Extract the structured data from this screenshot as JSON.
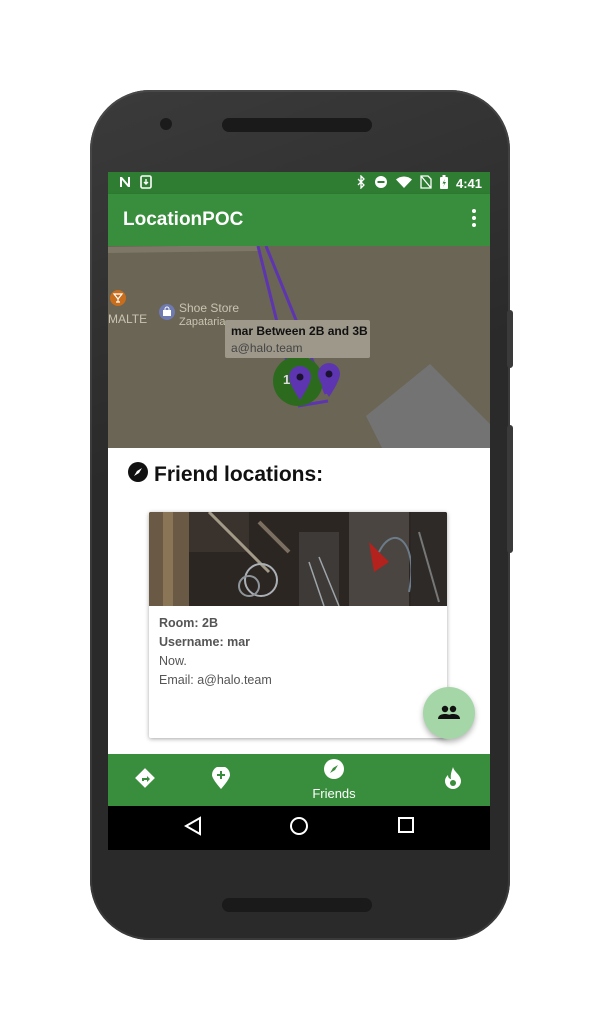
{
  "status_bar": {
    "time": "4:41",
    "left_icons": [
      "notification-n-icon",
      "download-icon"
    ],
    "right_icons": [
      "bluetooth-icon",
      "do-not-disturb-icon",
      "wifi-icon",
      "no-sim-icon",
      "battery-charging-icon"
    ]
  },
  "app_bar": {
    "title": "LocationPOC",
    "menu_icon": "overflow-menu-icon"
  },
  "map": {
    "poi_1_label": "MALTE",
    "poi_2_label": "Shoe Store",
    "poi_2_sublabel": "Zapataria",
    "cluster_label": "1+",
    "info_window": {
      "title": "mar Between 2B and 3B",
      "subtitle": "a@halo.team"
    }
  },
  "friends": {
    "heading": "Friend locations:",
    "heading_icon": "compass-icon",
    "card": {
      "room": "Room: 2B",
      "username": "Username: mar",
      "time": "Now.",
      "email": "Email: a@halo.team"
    }
  },
  "fab": {
    "icon": "people-icon"
  },
  "bottom_nav": {
    "items": [
      {
        "icon": "directions-icon",
        "label": ""
      },
      {
        "icon": "add-location-icon",
        "label": ""
      },
      {
        "icon": "compass-icon",
        "label": "Friends"
      },
      {
        "icon": "flame-icon",
        "label": ""
      }
    ]
  },
  "colors": {
    "primary": "#388e3c",
    "primary_dark": "#2e7d32",
    "fab": "#a5d6a7",
    "map_marker": "#5e35b1"
  }
}
